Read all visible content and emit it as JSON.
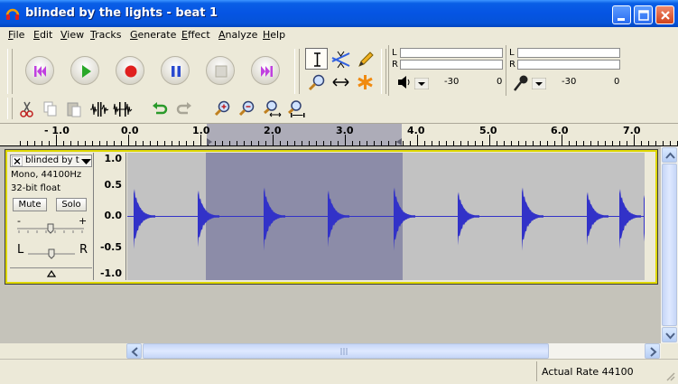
{
  "window": {
    "title": "blinded by the lights - beat 1"
  },
  "menu": {
    "items": [
      "File",
      "Edit",
      "View",
      "Tracks",
      "Generate",
      "Effect",
      "Analyze",
      "Help"
    ]
  },
  "meters": {
    "playback": {
      "left_channel": "L",
      "right_channel": "R",
      "scale_mid": "-30",
      "scale_end": "0"
    },
    "record": {
      "left_channel": "L",
      "right_channel": "R",
      "scale_mid": "-30",
      "scale_end": "0"
    }
  },
  "ruler": {
    "labels": [
      "- 1.0",
      "0.0",
      "1.0",
      "2.0",
      "3.0",
      "4.0",
      "5.0",
      "6.0",
      "7.0"
    ]
  },
  "track": {
    "name": "blinded by t",
    "format_line1": "Mono, 44100Hz",
    "format_line2": "32-bit float",
    "mute_label": "Mute",
    "solo_label": "Solo",
    "gain_minus": "-",
    "gain_plus": "+",
    "pan_left": "L",
    "pan_right": "R",
    "scale_labels": [
      "1.0",
      "0.5",
      "0.0",
      "-0.5",
      "-1.0"
    ]
  },
  "status": {
    "text": "Actual Rate 44100"
  },
  "colors": {
    "waveform": "#3232c8",
    "selection": "#8c8ca8",
    "track_focus_border": "#ded700"
  }
}
